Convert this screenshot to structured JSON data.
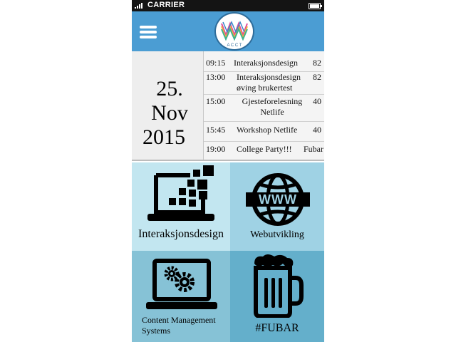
{
  "status_bar": {
    "carrier": "CARRIER",
    "signal_icon": "signal-bars-icon",
    "battery_icon": "battery-icon"
  },
  "navbar": {
    "menu_icon": "hamburger-menu-icon",
    "logo": {
      "name": "acct-logo",
      "letters": "A C C T"
    },
    "accent": "#4b9dd3"
  },
  "schedule": {
    "date_day": "25. Nov",
    "date_year": "2015",
    "events": [
      {
        "time": "09:15",
        "title": "Interaksjonsdesign",
        "room": "82"
      },
      {
        "time": "13:00",
        "title": "Interaksjonsdesign øving brukertest",
        "room": "82"
      },
      {
        "time": "15:00",
        "title": "Gjesteforelesning Netlife",
        "room": "40"
      },
      {
        "time": "15:45",
        "title": "Workshop Netlife",
        "room": "40"
      },
      {
        "time": "19:00",
        "title": "College Party!!!",
        "room": "Fubar"
      }
    ]
  },
  "tiles": [
    {
      "label": "Interaksjonsdesign",
      "icon": "laptop-pixels-icon",
      "color": "#c2e6f0"
    },
    {
      "label": "Webutvikling",
      "icon": "www-globe-icon",
      "color": "#9fd2e4"
    },
    {
      "label": "Content Management Systems",
      "icon": "laptop-gears-icon",
      "color": "#86c2d6"
    },
    {
      "label": "#FUBAR",
      "icon": "beer-mug-icon",
      "color": "#64afcb"
    }
  ]
}
